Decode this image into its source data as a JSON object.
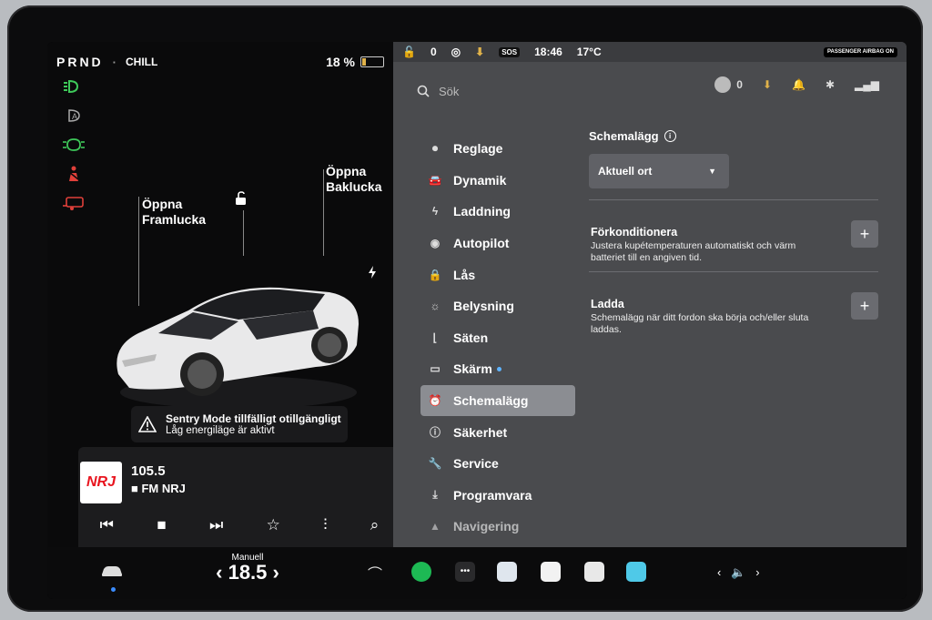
{
  "left": {
    "gear": "PRND",
    "drive_mode": "CHILL",
    "battery_percent": "18 %",
    "battery_level": 0.18,
    "front_trunk_label_1": "Öppna",
    "front_trunk_label_2": "Framlucka",
    "rear_trunk_label_1": "Öppna",
    "rear_trunk_label_2": "Baklucka",
    "sentry_title": "Sentry Mode tillfälligt otillgängligt",
    "sentry_sub": "Låg energiläge är aktivt"
  },
  "media": {
    "logo_text": "NRJ",
    "frequency": "105.5",
    "station": "FM NRJ"
  },
  "status": {
    "time": "18:46",
    "temp": "17°C",
    "sos": "SOS",
    "passenger_airbag": "PASSENGER AIRBAG ON",
    "profile_count": "0"
  },
  "search": {
    "placeholder": "Sök"
  },
  "menu": [
    {
      "label": "Reglage",
      "icon": "toggle-icon"
    },
    {
      "label": "Dynamik",
      "icon": "car-icon"
    },
    {
      "label": "Laddning",
      "icon": "bolt-icon"
    },
    {
      "label": "Autopilot",
      "icon": "steering-wheel-icon"
    },
    {
      "label": "Lås",
      "icon": "lock-icon"
    },
    {
      "label": "Belysning",
      "icon": "sun-icon"
    },
    {
      "label": "Säten",
      "icon": "seat-icon"
    },
    {
      "label": "Skärm",
      "icon": "display-icon"
    },
    {
      "label": "Schemalägg",
      "icon": "alarm-clock-icon"
    },
    {
      "label": "Säkerhet",
      "icon": "info-circle-icon"
    },
    {
      "label": "Service",
      "icon": "wrench-icon"
    },
    {
      "label": "Programvara",
      "icon": "download-icon"
    },
    {
      "label": "Navigering",
      "icon": "navigation-icon"
    }
  ],
  "content": {
    "title": "Schemalägg",
    "dropdown_value": "Aktuell ort",
    "precondition_title": "Förkonditionera",
    "precondition_desc": "Justera kupétemperaturen automatiskt och värm batteriet till en angiven tid.",
    "charge_title": "Ladda",
    "charge_desc": "Schemalägg när ditt fordon ska börja och/eller sluta laddas."
  },
  "dock": {
    "climate_mode": "Manuell",
    "temperature": "18.5"
  },
  "colors": {
    "accent": "#3b8cff",
    "battery": "#e0b24a",
    "panel": "#4a4b4e",
    "active_item": "#8b8d92"
  }
}
